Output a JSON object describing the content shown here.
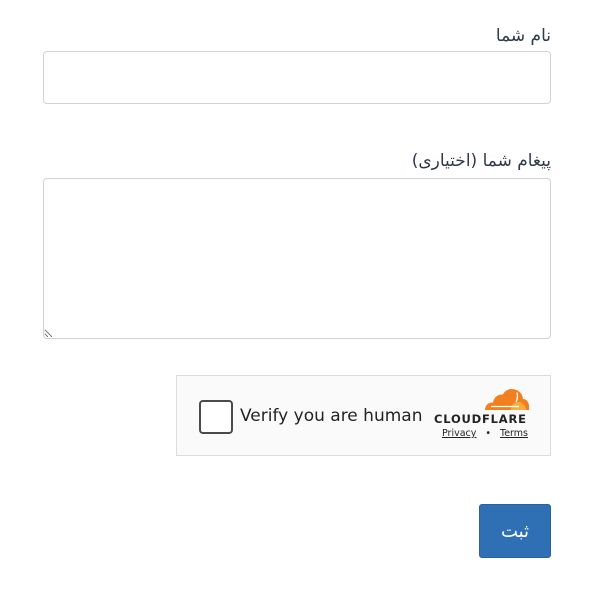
{
  "form": {
    "name_label": "نام شما",
    "name_value": "",
    "message_label": "پیغام شما (اختیاری)",
    "message_value": "",
    "submit_label": "ثبت",
    "submit_color": "#2f6fb3"
  },
  "turnstile": {
    "checkbox_checked": false,
    "verify_text": "Verify you are human",
    "brand": "CLOUDFLARE",
    "brand_color": "#f38020",
    "privacy_link": "Privacy",
    "separator": "•",
    "terms_link": "Terms"
  }
}
